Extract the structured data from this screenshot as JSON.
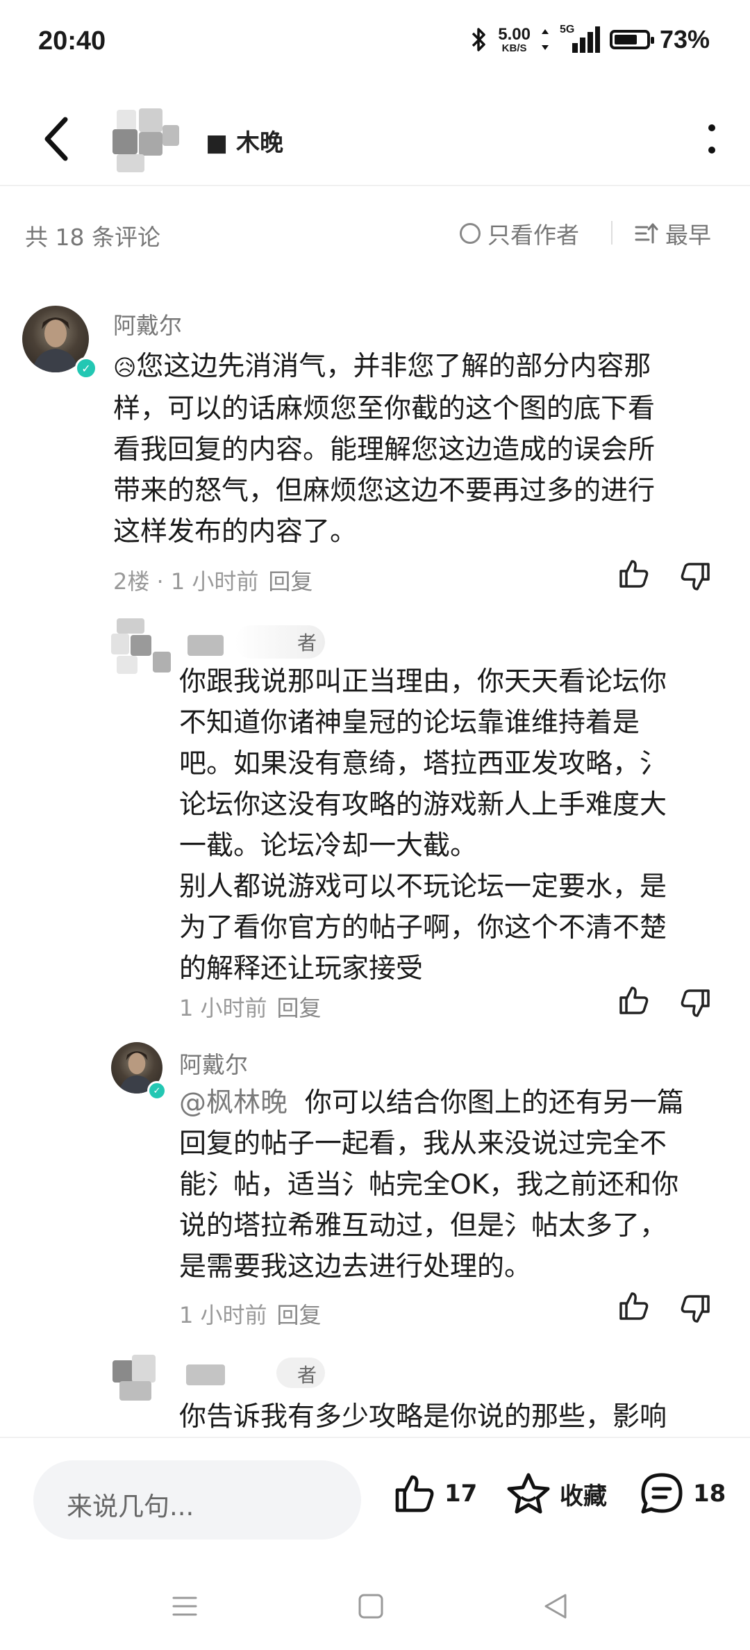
{
  "status_bar": {
    "time": "20:40",
    "net_speed_value": "5.00",
    "net_speed_unit": "KB/S",
    "network": "5G",
    "battery_percent": "73%",
    "battery_level": 0.73
  },
  "header": {
    "title": "■ 木晚"
  },
  "toolbar": {
    "comment_count": "共 18 条评论",
    "author_only_label": "只看作者",
    "sort_label": "最早"
  },
  "comments": [
    {
      "author": "阿戴尔",
      "emoji": "😥",
      "text": "您这边先消消气，并非您了解的部分内容那\n样，可以的话麻烦您至你截的这个图的底下看\n看我回复的内容。能理解您这边造成的误会所\n带来的怒气，但麻烦您这边不要再过多的进行\n这样发布的内容了。",
      "meta": "2楼 · 1 小时前",
      "reply_label": "回复"
    },
    {
      "author": "",
      "author_tag": "者",
      "text": "你跟我说那叫正当理由，你天天看论坛你\n不知道你诸神皇冠的论坛靠谁维持着是\n吧。如果没有意绮，塔拉西亚发攻略，氵\n论坛你这没有攻略的游戏新人上手难度大\n一截。论坛冷却一大截。\n别人都说游戏可以不玩论坛一定要水，是\n为了看你官方的帖子啊，你这个不清不楚\n的解释还让玩家接受",
      "meta": "1 小时前",
      "reply_label": "回复"
    },
    {
      "author": "阿戴尔",
      "mention": "@枫林晚",
      "text": "你可以结合你图上的还有另一篇\n回复的帖子一起看，我从来没说过完全不\n能氵帖，适当氵帖完全OK，我之前还和你\n说的塔拉希雅互动过，但是氵帖太多了，\n是需要我这边去进行处理的。",
      "meta": "1 小时前",
      "reply_label": "回复"
    },
    {
      "author": "",
      "author_tag": "者",
      "text": "你告诉我有多少攻略是你说的那些，影响"
    }
  ],
  "bottom_bar": {
    "input_placeholder": "来说几句...",
    "like_count": "17",
    "favorite_label": "收藏",
    "comment_count": "18"
  },
  "colors": {
    "verify_badge": "#23c7b3",
    "muted_text": "#777777"
  }
}
